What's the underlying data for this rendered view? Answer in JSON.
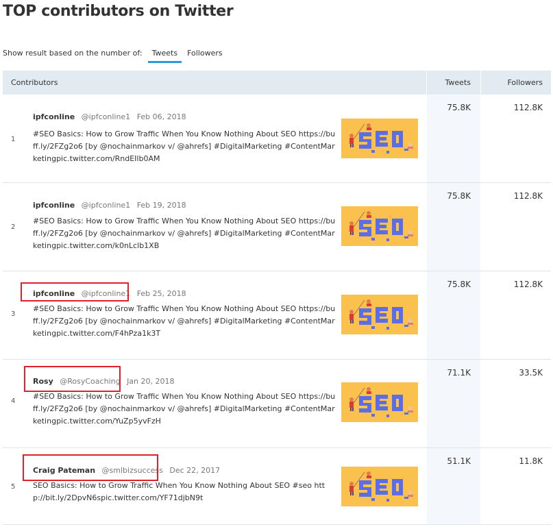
{
  "page": {
    "title": "TOP contributors on Twitter"
  },
  "filter": {
    "label": "Show result based on the number of:",
    "tabs": [
      {
        "label": "Tweets",
        "active": true
      },
      {
        "label": "Followers",
        "active": false
      }
    ]
  },
  "table": {
    "headers": {
      "contributors": "Contributors",
      "tweets": "Tweets",
      "followers": "Followers"
    },
    "rows": [
      {
        "rank": "1",
        "author": "ipfconline",
        "handle": "@ipfconline1",
        "date": "Feb 06, 2018",
        "text": "#SEO Basics: How to Grow Traffic When You Know Nothing About SEO https://buff.ly/2FZg2o6 [by @nochainmarkov v/ @ahrefs] #DigitalMarketing #ContentMarketingpic.twitter.com/RndEIlb0AM",
        "thumbnail": "seo-illustration-image",
        "tweets": "75.8K",
        "followers": "112.8K",
        "highlighted": false
      },
      {
        "rank": "2",
        "author": "ipfconline",
        "handle": "@ipfconline1",
        "date": "Feb 19, 2018",
        "text": "#SEO Basics: How to Grow Traffic When You Know Nothing About SEO https://buff.ly/2FZg2o6 [by @nochainmarkov v/ @ahrefs] #DigitalMarketing #ContentMarketingpic.twitter.com/k0nLclb1XB",
        "thumbnail": "seo-illustration-image",
        "tweets": "75.8K",
        "followers": "112.8K",
        "highlighted": false
      },
      {
        "rank": "3",
        "author": "ipfconline",
        "handle": "@ipfconline1",
        "date": "Feb 25, 2018",
        "text": "#SEO Basics: How to Grow Traffic When You Know Nothing About SEO https://buff.ly/2FZg2o6 [by @nochainmarkov v/ @ahrefs] #DigitalMarketing #ContentMarketingpic.twitter.com/F4hPza1k3T",
        "thumbnail": "seo-illustration-image",
        "tweets": "75.8K",
        "followers": "112.8K",
        "highlighted": true
      },
      {
        "rank": "4",
        "author": "Rosy",
        "handle": "@RosyCoaching",
        "date": "Jan 20, 2018",
        "text": "#SEO Basics: How to Grow Traffic When You Know Nothing About SEO https://buff.ly/2FZg2o6 [by @nochainmarkov v/ @ahrefs] #DigitalMarketing #ContentMarketingpic.twitter.com/YuZp5yvFzH",
        "thumbnail": "seo-illustration-image",
        "tweets": "71.1K",
        "followers": "33.5K",
        "highlighted": true
      },
      {
        "rank": "5",
        "author": "Craig Pateman",
        "handle": "@smlbizsuccess",
        "date": "Dec 22, 2017",
        "text": "SEO Basics: How to Grow Traffic When You Know Nothing About SEO #seo http://bit.ly/2DpvN6spic.twitter.com/YF71djbN9t",
        "thumbnail": "seo-illustration-image",
        "tweets": "51.1K",
        "followers": "11.8K",
        "highlighted": true
      }
    ]
  },
  "colors": {
    "accent": "#2d9ad8",
    "header_bg": "#e2ebf1",
    "tweets_column_bg": "#f4f8fc",
    "highlight_box": "#e0202a",
    "thumbnail_bg": "#fbc14f"
  }
}
